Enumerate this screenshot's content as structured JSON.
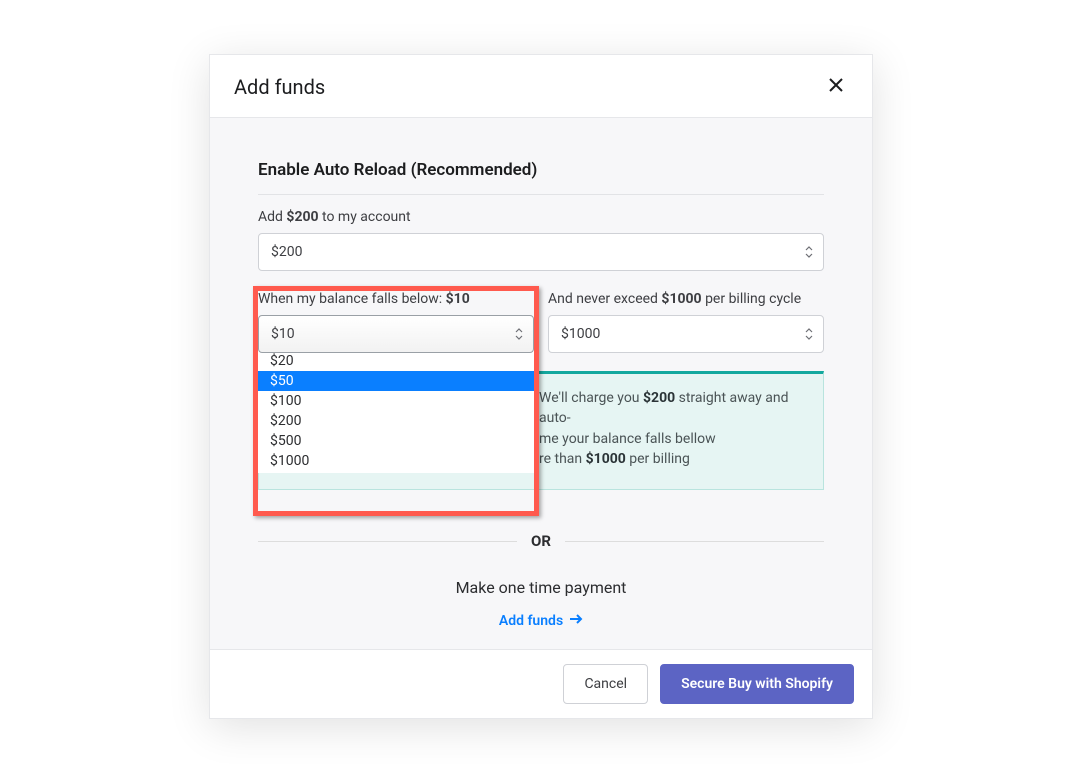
{
  "modal": {
    "title": "Add funds",
    "section_title": "Enable Auto Reload (Recommended)",
    "add_label_prefix": "Add ",
    "add_label_amount": "$200",
    "add_label_suffix": " to my account",
    "amount_select": {
      "value": "$200"
    },
    "threshold": {
      "label_prefix": "When my balance falls below: ",
      "label_amount": "$10",
      "value": "$10",
      "options": [
        "$10",
        "$20",
        "$50",
        "$100",
        "$200",
        "$500",
        "$1000"
      ],
      "highlighted_index": 2
    },
    "cap": {
      "label_prefix": "And never exceed ",
      "label_amount": "$1000",
      "label_suffix": " per billing cycle",
      "value": "$1000"
    },
    "info": {
      "line1_a": "We'll charge you ",
      "line1_b": "$200",
      "line1_c": " straight away and auto-",
      "line2_a": "me your balance falls bellow",
      "line3_a": "re than ",
      "line3_b": "$1000",
      "line3_c": " per billing"
    },
    "or": "OR",
    "one_time_title": "Make one time payment",
    "add_funds_link": "Add funds",
    "footer": {
      "cancel": "Cancel",
      "primary": "Secure Buy with Shopify"
    }
  }
}
